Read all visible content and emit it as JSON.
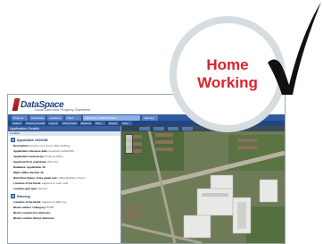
{
  "app": {
    "logo_text": "DataSpace",
    "logo_subtitle": "Local Land and Property Gazetteer"
  },
  "tabs": [
    "Property",
    "Addresses",
    "Highways",
    "Maps",
    "Application (Office Builder)",
    "Planning"
  ],
  "active_tab_index": 4,
  "toolbar": [
    "Search",
    "Property Details",
    "Layers",
    "Street View",
    "Measure",
    "Print",
    "Export",
    "Help"
  ],
  "panel": {
    "title": "Application Details",
    "subtitle": "Location",
    "section_main": "Application 16/00456",
    "fields": [
      {
        "label": "Description:",
        "value": "Erection of 2 storey office building"
      },
      {
        "label": "Application reference date:",
        "value": "Received 12/04/2016"
      },
      {
        "label": "Application received by:",
        "value": "Planning Office"
      },
      {
        "label": "Applicant Post code/Area:",
        "value": "PE1 1AA"
      },
      {
        "label": "Database: Application 16",
        "value": ""
      },
      {
        "label": "Ward: Office Section 16",
        "value": ""
      },
      {
        "label": "Brief Description of the grade size:",
        "value": "Office Building 3 floors"
      }
    ],
    "fields_more": [
      {
        "label": "Location of the block:",
        "value": "Adjacent to main road"
      },
      {
        "label": "Location grid type:",
        "value": "Normal"
      }
    ],
    "section_second": "Planning",
    "fields_second": [
      {
        "label": "Location of the block:",
        "value": "Adjacent to Rail Line"
      },
      {
        "label": "Block number / Category:",
        "value": "B/456"
      },
      {
        "label": "Block Location list reference:",
        "value": ""
      },
      {
        "label": "Block Location Street reference:",
        "value": ""
      }
    ]
  },
  "circle": {
    "line1": "Home",
    "line2": "Working"
  },
  "colors": {
    "accent": "#d8242c",
    "ring": "#d6dde0",
    "app_blue": "#2d5aa0"
  },
  "icons": [
    "checkmark-icon",
    "map-zoom-icon"
  ]
}
